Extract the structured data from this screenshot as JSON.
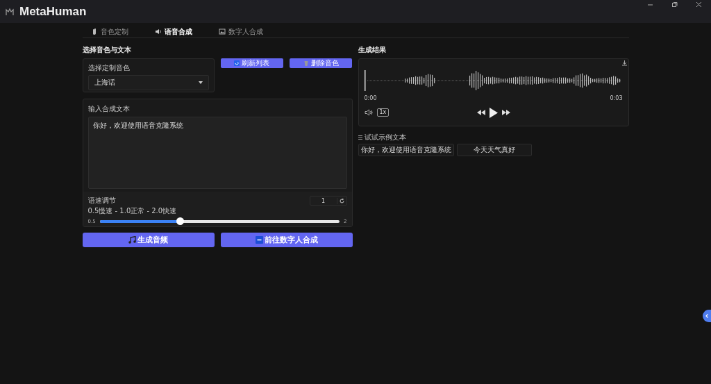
{
  "window": {
    "title": "MetaHuman"
  },
  "tabs": [
    {
      "label": "音色定制",
      "selected": false
    },
    {
      "label": "语音合成",
      "selected": true
    },
    {
      "label": "数字人合成",
      "selected": false
    }
  ],
  "left": {
    "title": "选择音色与文本",
    "voice_select": {
      "label": "选择定制音色",
      "value": "上海话"
    },
    "buttons": [
      {
        "label": "刷新列表"
      },
      {
        "label": "删除音色"
      }
    ],
    "text_input": {
      "label": "输入合成文本",
      "value": "你好，欢迎使用语音克隆系统"
    },
    "speed": {
      "label": "语速调节",
      "hint": "0.5慢速 - 1.0正常 - 2.0快速",
      "value": "1",
      "min": "0.5",
      "max": "2",
      "level": 0.333
    },
    "actions": [
      {
        "label": "生成音频"
      },
      {
        "label": "前往数字人合成"
      }
    ]
  },
  "right": {
    "title": "生成结果",
    "player": {
      "current_time": "0:00",
      "duration": "0:03",
      "speed": "1x"
    },
    "examples": {
      "label": "试试示例文本",
      "items": [
        "你好，欢迎使用语音克隆系统",
        "今天天气真好"
      ]
    }
  }
}
